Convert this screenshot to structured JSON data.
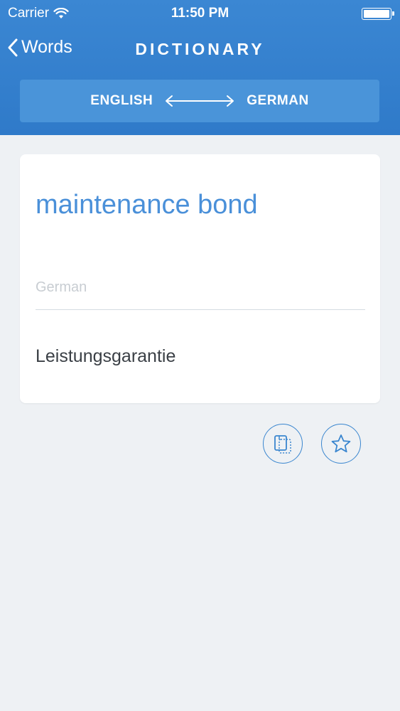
{
  "status_bar": {
    "carrier": "Carrier",
    "time": "11:50 PM"
  },
  "nav": {
    "back_label": "Words",
    "title": "DICTIONARY"
  },
  "language_switch": {
    "source": "ENGLISH",
    "target": "GERMAN"
  },
  "entry": {
    "term": "maintenance bond",
    "target_language_label": "German",
    "translation": "Leistungsgarantie"
  },
  "actions": {
    "copy_icon": "copy-icon",
    "favorite_icon": "star-icon"
  },
  "colors": {
    "header": "#2f7ac9",
    "accent": "#4a90d9",
    "background": "#eef1f4"
  }
}
